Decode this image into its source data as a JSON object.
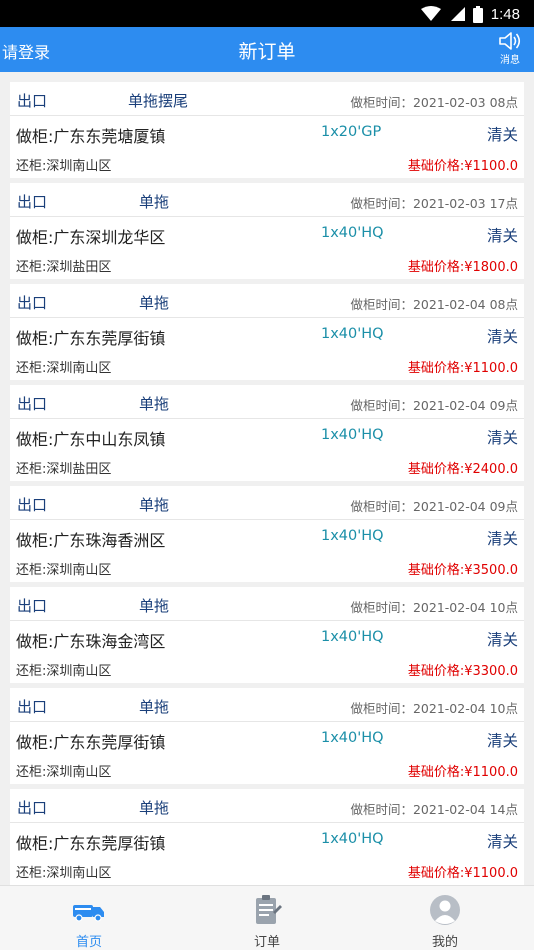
{
  "status_bar": {
    "time": "1:48",
    "icons": [
      "wifi-icon",
      "signal-icon",
      "battery-icon"
    ]
  },
  "header": {
    "login": "请登录",
    "title": "新订单",
    "message_label": "消息",
    "bg_color": "#2d8cf0"
  },
  "orders": [
    {
      "direction": "出口",
      "type": "单拖摆尾",
      "time_label": "做柜时间：",
      "time": "2021-02-03 08点",
      "from": "做柜:广东东莞塘厦镇",
      "spec": "1x20'GP",
      "customs": "清关",
      "to": "还柜:深圳南山区",
      "price_label": "基础价格:",
      "price": "¥1100.0"
    },
    {
      "direction": "出口",
      "type": "单拖",
      "time_label": "做柜时间：",
      "time": "2021-02-03 17点",
      "from": "做柜:广东深圳龙华区",
      "spec": "1x40'HQ",
      "customs": "清关",
      "to": "还柜:深圳盐田区",
      "price_label": "基础价格:",
      "price": "¥1800.0"
    },
    {
      "direction": "出口",
      "type": "单拖",
      "time_label": "做柜时间：",
      "time": "2021-02-04 08点",
      "from": "做柜:广东东莞厚街镇",
      "spec": "1x40'HQ",
      "customs": "清关",
      "to": "还柜:深圳南山区",
      "price_label": "基础价格:",
      "price": "¥1100.0"
    },
    {
      "direction": "出口",
      "type": "单拖",
      "time_label": "做柜时间：",
      "time": "2021-02-04 09点",
      "from": "做柜:广东中山东凤镇",
      "spec": "1x40'HQ",
      "customs": "清关",
      "to": "还柜:深圳盐田区",
      "price_label": "基础价格:",
      "price": "¥2400.0"
    },
    {
      "direction": "出口",
      "type": "单拖",
      "time_label": "做柜时间：",
      "time": "2021-02-04 09点",
      "from": "做柜:广东珠海香洲区",
      "spec": "1x40'HQ",
      "customs": "清关",
      "to": "还柜:深圳南山区",
      "price_label": "基础价格:",
      "price": "¥3500.0"
    },
    {
      "direction": "出口",
      "type": "单拖",
      "time_label": "做柜时间：",
      "time": "2021-02-04 10点",
      "from": "做柜:广东珠海金湾区",
      "spec": "1x40'HQ",
      "customs": "清关",
      "to": "还柜:深圳南山区",
      "price_label": "基础价格:",
      "price": "¥3300.0"
    },
    {
      "direction": "出口",
      "type": "单拖",
      "time_label": "做柜时间：",
      "time": "2021-02-04 10点",
      "from": "做柜:广东东莞厚街镇",
      "spec": "1x40'HQ",
      "customs": "清关",
      "to": "还柜:深圳南山区",
      "price_label": "基础价格:",
      "price": "¥1100.0"
    },
    {
      "direction": "出口",
      "type": "单拖",
      "time_label": "做柜时间：",
      "time": "2021-02-04 14点",
      "from": "做柜:广东东莞厚街镇",
      "spec": "1x40'HQ",
      "customs": "清关",
      "to": "还柜:深圳南山区",
      "price_label": "基础价格:",
      "price": "¥1100.0"
    }
  ],
  "tabbar": {
    "tabs": [
      {
        "label": "首页",
        "icon": "truck-icon",
        "active": true
      },
      {
        "label": "订单",
        "icon": "clipboard-icon",
        "active": false
      },
      {
        "label": "我的",
        "icon": "user-icon",
        "active": false
      }
    ]
  }
}
